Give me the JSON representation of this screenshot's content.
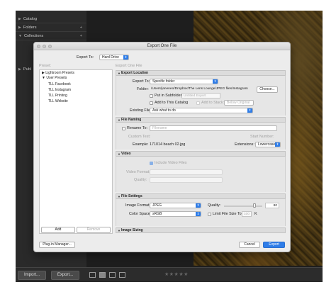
{
  "lightroom": {
    "left_panel": [
      {
        "label": "Catalog",
        "plus": ""
      },
      {
        "label": "Folders",
        "plus": "+"
      },
      {
        "label": "Collections",
        "plus": "+"
      },
      {
        "label": "Publ",
        "plus": ""
      }
    ],
    "bottom": {
      "import_label": "Import...",
      "export_label": "Export...",
      "stars": "★★★★★"
    }
  },
  "dialog": {
    "title": "Export One File",
    "export_to_label": "Export To:",
    "export_to_value": "Hard Drive",
    "preset_header": "Preset:",
    "content_header": "Export One File",
    "presets": [
      {
        "label": "Lightroom Presets",
        "indent": 0,
        "tri": "▶"
      },
      {
        "label": "User Presets",
        "indent": 0,
        "tri": "▼"
      },
      {
        "label": "TLL Facebook",
        "indent": 1,
        "tri": ""
      },
      {
        "label": "TLL Instagram",
        "indent": 1,
        "tri": ""
      },
      {
        "label": "TLL Printing",
        "indent": 1,
        "tri": ""
      },
      {
        "label": "TLL Website",
        "indent": 1,
        "tri": ""
      }
    ],
    "add_label": "Add",
    "remove_label": "Remove",
    "export_location": {
      "header": "Export Location",
      "export_to_label": "Export To:",
      "export_to_value": "Specific folder",
      "folder_label": "Folder:",
      "folder_value": "/Users/janeneo/Dropbox/The Lens Lounge/JPEG files/Instagram",
      "choose_label": "Choose...",
      "put_in_subfolder_label": "Put in Subfolder:",
      "subfolder_placeholder": "Untitled Export",
      "add_to_catalog_label": "Add to This Catalog",
      "add_to_stack_label": "Add to Stack:",
      "below_original": "Below Original",
      "existing_files_label": "Existing Files:",
      "existing_files_value": "Ask what to do"
    },
    "file_naming": {
      "header": "File Naming",
      "rename_to_label": "Rename To:",
      "rename_to_value": "Filename",
      "custom_text_label": "Custom Text:",
      "start_number_label": "Start Number:",
      "example_label": "Example:",
      "example_value": "171014 beach 02.jpg",
      "extensions_label": "Extensions:",
      "extensions_value": "Lowercase"
    },
    "video": {
      "header": "Video",
      "include_video_label": "Include Video Files",
      "video_format_label": "Video Format:",
      "quality_label": "Quality:"
    },
    "file_settings": {
      "header": "File Settings",
      "image_format_label": "Image Format:",
      "image_format_value": "JPEG",
      "quality_label": "Quality:",
      "quality_value": "80",
      "quality_fraction": 0.8,
      "color_space_label": "Color Space:",
      "color_space_value": "sRGB",
      "limit_file_size_label": "Limit File Size To:",
      "limit_file_size_value": "100",
      "limit_unit": "K"
    },
    "image_sizing": {
      "header": "Image Sizing"
    },
    "plugin_manager_label": "Plug-in Manager...",
    "cancel_label": "Cancel",
    "export_label": "Export"
  }
}
